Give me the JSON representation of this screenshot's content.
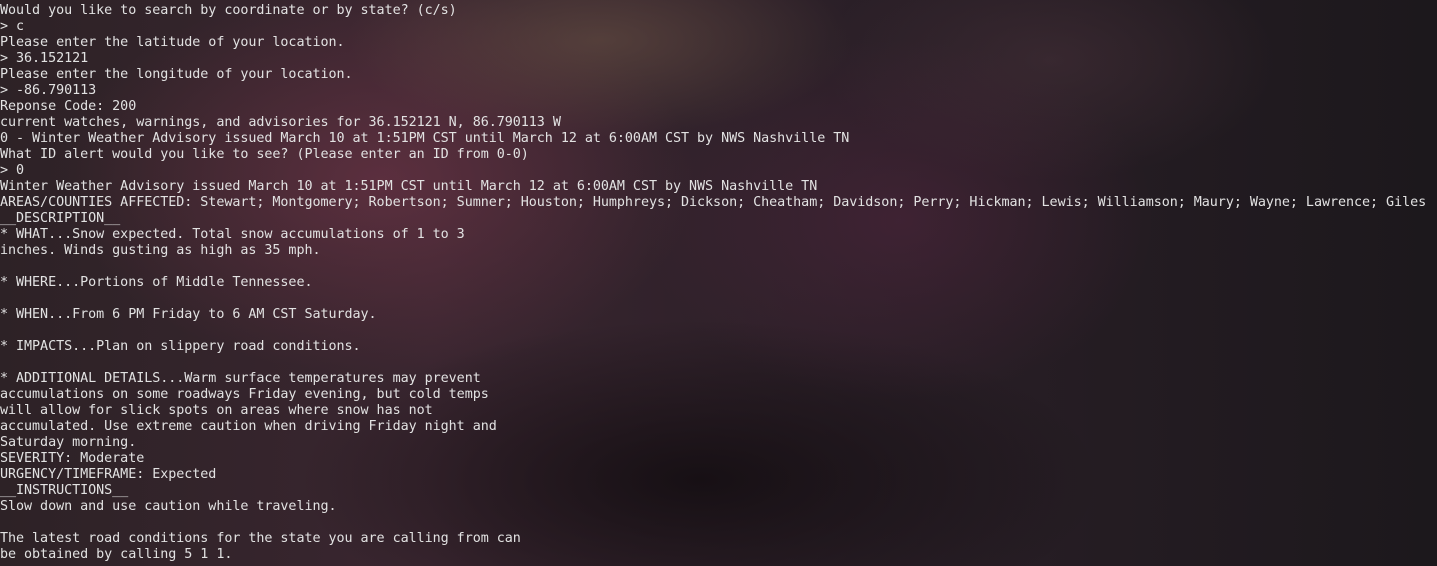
{
  "terminal": {
    "lines": [
      "Would you like to search by coordinate or by state? (c/s)",
      "> c",
      "Please enter the latitude of your location.",
      "> 36.152121",
      "Please enter the longitude of your location.",
      "> -86.790113",
      "Reponse Code: 200",
      "current watches, warnings, and advisories for 36.152121 N, 86.790113 W",
      "0 - Winter Weather Advisory issued March 10 at 1:51PM CST until March 12 at 6:00AM CST by NWS Nashville TN",
      "What ID alert would you like to see? (Please enter an ID from 0-0)",
      "> 0",
      "Winter Weather Advisory issued March 10 at 1:51PM CST until March 12 at 6:00AM CST by NWS Nashville TN",
      "AREAS/COUNTIES AFFECTED: Stewart; Montgomery; Robertson; Sumner; Houston; Humphreys; Dickson; Cheatham; Davidson; Perry; Hickman; Lewis; Williamson; Maury; Wayne; Lawrence; Giles",
      "__DESCRIPTION__",
      "* WHAT...Snow expected. Total snow accumulations of 1 to 3",
      "inches. Winds gusting as high as 35 mph.",
      "",
      "* WHERE...Portions of Middle Tennessee.",
      "",
      "* WHEN...From 6 PM Friday to 6 AM CST Saturday.",
      "",
      "* IMPACTS...Plan on slippery road conditions.",
      "",
      "* ADDITIONAL DETAILS...Warm surface temperatures may prevent",
      "accumulations on some roadways Friday evening, but cold temps",
      "will allow for slick spots on areas where snow has not",
      "accumulated. Use extreme caution when driving Friday night and",
      "Saturday morning.",
      "SEVERITY: Moderate",
      "URGENCY/TIMEFRAME: Expected",
      "__INSTRUCTIONS__",
      "Slow down and use caution while traveling.",
      "",
      "The latest road conditions for the state you are calling from can",
      "be obtained by calling 5 1 1."
    ]
  }
}
